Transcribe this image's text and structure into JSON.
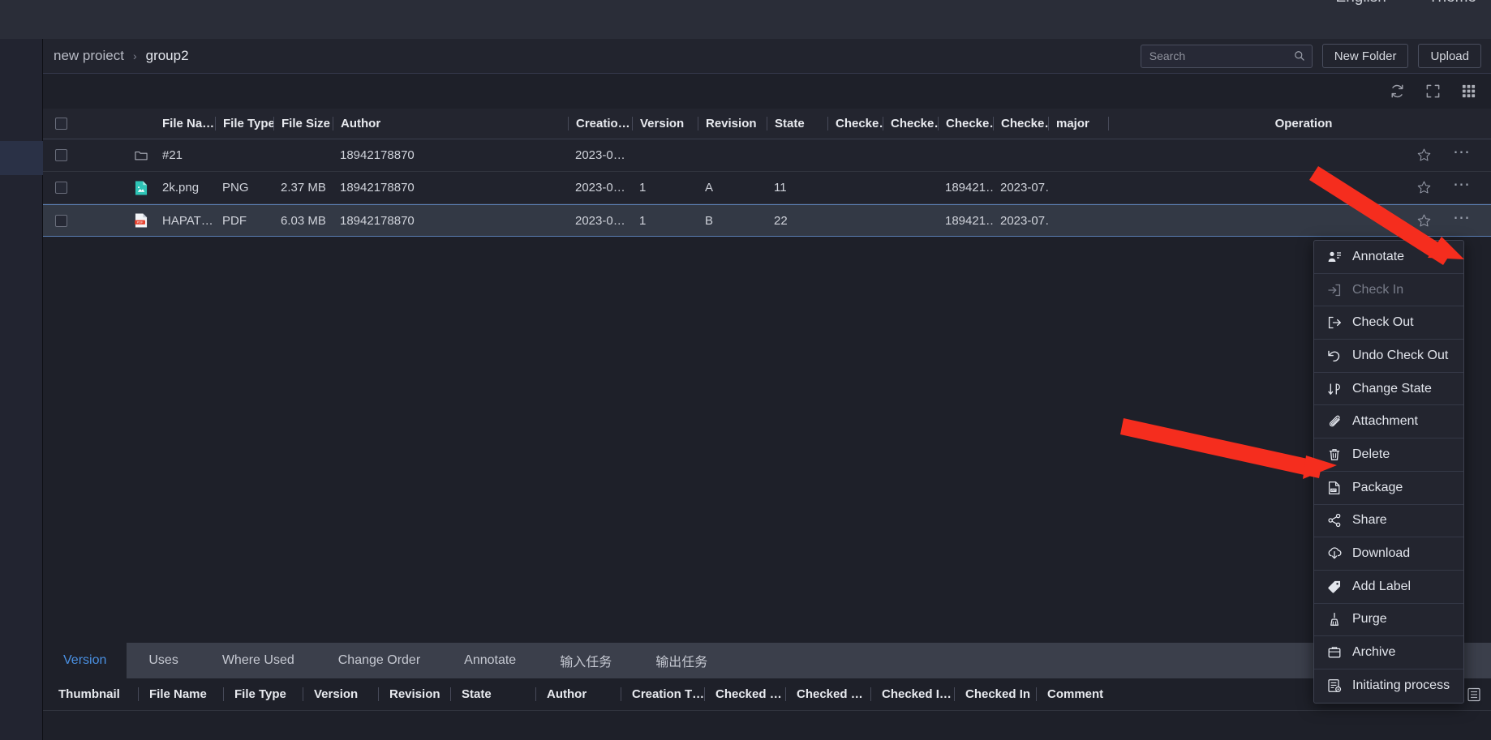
{
  "topbar": {
    "links": [
      {
        "label": "English",
        "name": "language-switch"
      },
      {
        "label": "Theme",
        "name": "theme-switch"
      }
    ]
  },
  "breadcrumb": {
    "root": "new proiect",
    "separator": "›",
    "current": "group2"
  },
  "search": {
    "value": "",
    "placeholder": "Search"
  },
  "actions": {
    "new_folder": "New Folder",
    "upload": "Upload"
  },
  "toolstrip": {
    "refresh": "refresh-icon",
    "fullscreen": "fullscreen-icon",
    "grid_view": "grid-view-icon"
  },
  "grid": {
    "columns": [
      "File Na…",
      "File Type",
      "File Size",
      "Author",
      "Creatio…",
      "Version",
      "Revision",
      "State",
      "Checke…",
      "Checke…",
      "Checke…",
      "Checke…",
      "major",
      "Operation"
    ],
    "rows": [
      {
        "icon": "folder-icon",
        "name": "#21",
        "type": "",
        "size": "",
        "author": "18942178870",
        "creation": "2023-0…",
        "version": "",
        "revision": "",
        "state": "",
        "checked1": "",
        "checked2": "",
        "checked3": "",
        "checked4": "",
        "major": "",
        "selected": false
      },
      {
        "icon": "png-file-icon",
        "name": "2k.png",
        "type": "PNG",
        "size": "2.37 MB",
        "author": "18942178870",
        "creation": "2023-0…",
        "version": "1",
        "revision": "A",
        "state": "11",
        "checked1": "",
        "checked2": "",
        "checked3": "189421…",
        "checked4": "2023-07…",
        "major": "",
        "selected": false
      },
      {
        "icon": "pdf-file-icon",
        "name": "HAPAT…",
        "type": "PDF",
        "size": "6.03 MB",
        "author": "18942178870",
        "creation": "2023-0…",
        "version": "1",
        "revision": "B",
        "state": "22",
        "checked1": "",
        "checked2": "",
        "checked3": "189421…",
        "checked4": "2023-07…",
        "major": "",
        "selected": true
      }
    ]
  },
  "context_menu": {
    "items": [
      {
        "label": "Annotate",
        "icon": "annotate-icon",
        "disabled": false
      },
      {
        "label": "Check In",
        "icon": "check-in-icon",
        "disabled": true
      },
      {
        "label": "Check Out",
        "icon": "check-out-icon",
        "disabled": false
      },
      {
        "label": "Undo Check Out",
        "icon": "undo-check-out-icon",
        "disabled": false
      },
      {
        "label": "Change State",
        "icon": "change-state-icon",
        "disabled": false
      },
      {
        "label": "Attachment",
        "icon": "attachment-icon",
        "disabled": false
      },
      {
        "label": "Delete",
        "icon": "delete-icon",
        "disabled": false
      },
      {
        "label": "Package",
        "icon": "package-zip-icon",
        "disabled": false
      },
      {
        "label": "Share",
        "icon": "share-icon",
        "disabled": false
      },
      {
        "label": "Download",
        "icon": "download-icon",
        "disabled": false
      },
      {
        "label": "Add Label",
        "icon": "label-tag-icon",
        "disabled": false
      },
      {
        "label": "Purge",
        "icon": "purge-broom-icon",
        "disabled": false
      },
      {
        "label": "Archive",
        "icon": "archive-icon",
        "disabled": false
      },
      {
        "label": "Initiating process",
        "icon": "initiate-process-icon",
        "disabled": false
      }
    ]
  },
  "detail": {
    "tabs": [
      {
        "label": "Version",
        "active": true
      },
      {
        "label": "Uses",
        "active": false
      },
      {
        "label": "Where Used",
        "active": false
      },
      {
        "label": "Change Order",
        "active": false
      },
      {
        "label": "Annotate",
        "active": false
      },
      {
        "label": "输入任务",
        "active": false
      },
      {
        "label": "输出任务",
        "active": false
      }
    ],
    "columns": [
      "Thumbnail",
      "File Name",
      "File Type",
      "Version",
      "Revision",
      "State",
      "Author",
      "Creation T…",
      "Checked …",
      "Checked …",
      "Checked I…",
      "Checked In",
      "Comment"
    ]
  },
  "colors": {
    "accent": "#4a90e2",
    "selected_row": "#333945",
    "selected_border": "#5b7fb5",
    "arrow": "#f52d1e",
    "png_icon": "#2ec4b6",
    "pdf_icon": "#e8412e"
  }
}
